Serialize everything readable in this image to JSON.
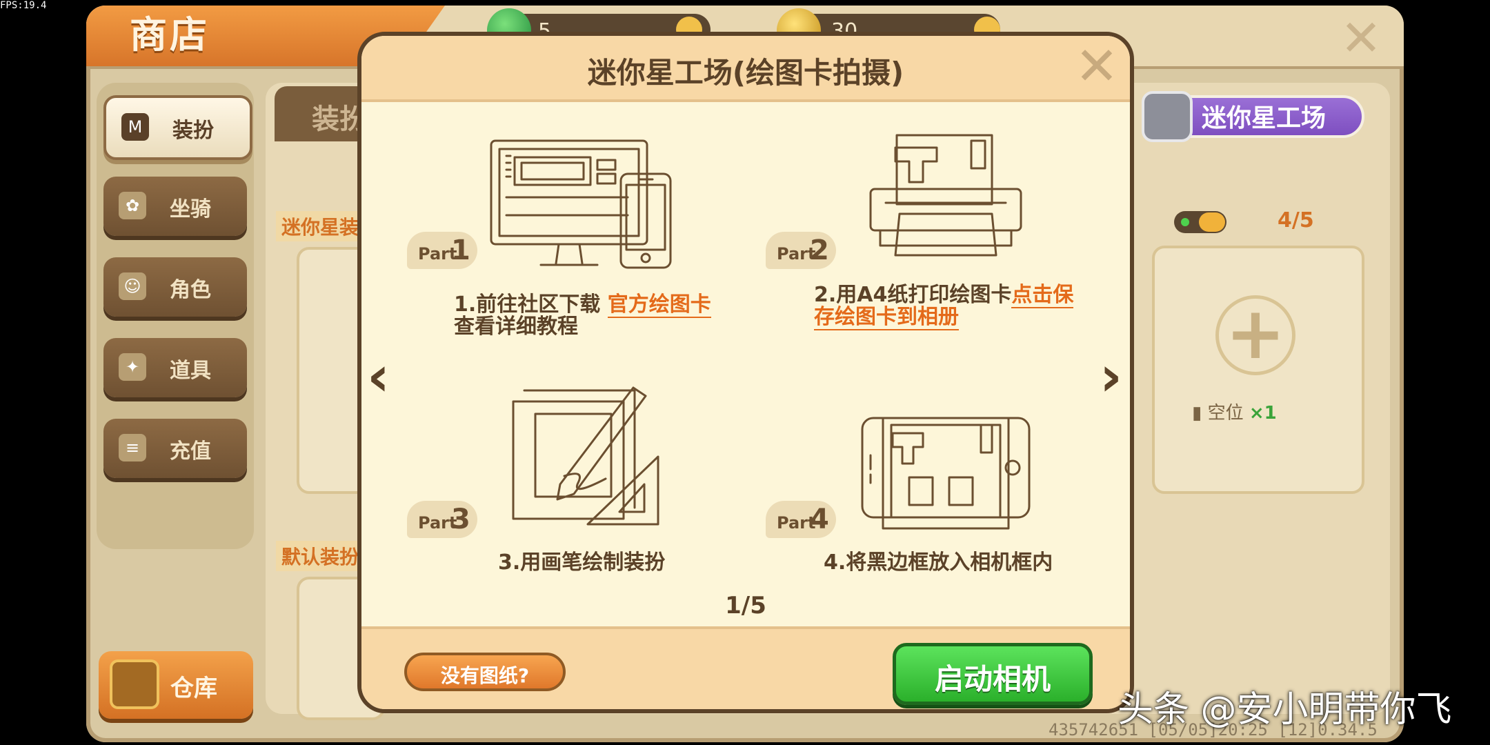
{
  "fps": "FPS:19.4",
  "shop": {
    "title": "商店",
    "currencies": [
      {
        "icon": "gem-icon",
        "value": "5"
      },
      {
        "icon": "coin-icon",
        "value": "30"
      }
    ],
    "sidebar": [
      {
        "label": "装扮",
        "icon": "shirt-icon",
        "active": true
      },
      {
        "label": "坐骑",
        "icon": "mount-icon",
        "active": false
      },
      {
        "label": "角色",
        "icon": "character-icon",
        "active": false
      },
      {
        "label": "道具",
        "icon": "party-popper-icon",
        "active": false
      },
      {
        "label": "充值",
        "icon": "coins-stack-icon",
        "active": false
      }
    ],
    "warehouse_label": "仓库",
    "content_tab": "装扮",
    "section_mini": "迷你星装",
    "section_default": "默认装扮",
    "mini_star_button": "迷你星工场",
    "slot_count": "4/5",
    "empty_slot_label": "空位",
    "empty_slot_count": "×1",
    "footer_id": "435742651  [05/05]20:25  [12]0.34.5"
  },
  "modal": {
    "title": "迷你星工场(绘图卡拍摄)",
    "steps": [
      {
        "part_word": "Part",
        "part_num": "1",
        "text_before": "1.前往社区下载 ",
        "highlight": "官方绘图卡",
        "text_after": "查看详细教程"
      },
      {
        "part_word": "Part",
        "part_num": "2",
        "text_before": "2.用A4纸打印绘图卡",
        "highlight": "点击保存绘图卡到相册",
        "text_after": ""
      },
      {
        "part_word": "Part",
        "part_num": "3",
        "text_before": "3.用画笔绘制装扮",
        "highlight": "",
        "text_after": ""
      },
      {
        "part_word": "Part",
        "part_num": "4",
        "text_before": "4.将黑边框放入相机框内",
        "highlight": "",
        "text_after": ""
      }
    ],
    "page_indicator": "1/5",
    "no_paper_button": "没有图纸?",
    "start_camera_button": "启动相机"
  },
  "watermark": "头条 @安小明带你飞",
  "colors": {
    "accent_orange": "#e46a1a",
    "green_button": "#2bb02b",
    "purple_pill": "#7e4fc0",
    "dark_brown": "#5b4228"
  }
}
